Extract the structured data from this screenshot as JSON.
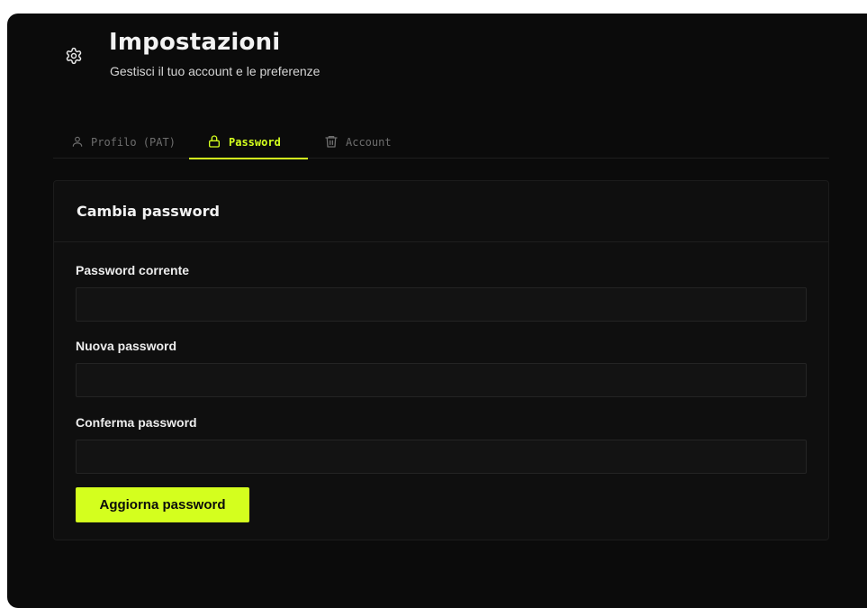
{
  "header": {
    "title": "Impostazioni",
    "subtitle": "Gestisci il tuo account e le preferenze",
    "icon": "gear-icon"
  },
  "tabs": [
    {
      "label": "Profilo (PAT)",
      "icon": "user-icon",
      "active": false
    },
    {
      "label": "Password",
      "icon": "lock-icon",
      "active": true
    },
    {
      "label": "Account",
      "icon": "trash-icon",
      "active": false
    }
  ],
  "form": {
    "title": "Cambia password",
    "fields": [
      {
        "label": "Password corrente",
        "value": ""
      },
      {
        "label": "Nuova password",
        "value": ""
      },
      {
        "label": "Conferma password",
        "value": ""
      }
    ],
    "submit_label": "Aggiorna password"
  },
  "colors": {
    "background": "#0b0b0b",
    "accent": "#d4ff1e",
    "text": "#f2f2f2",
    "muted": "#6e6e6e"
  }
}
